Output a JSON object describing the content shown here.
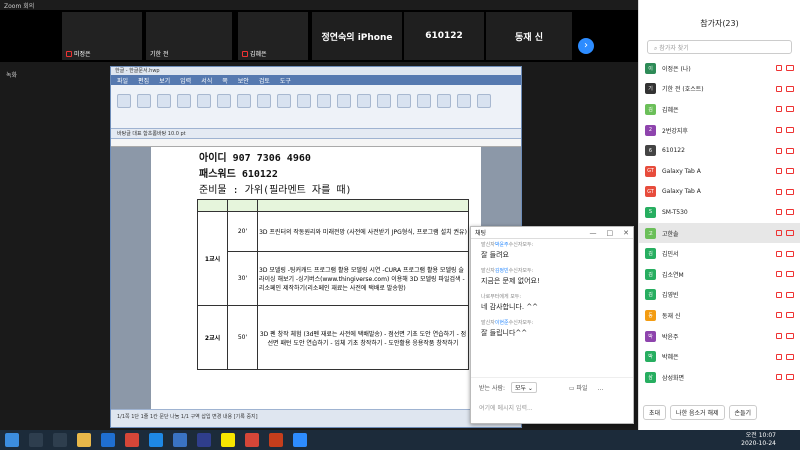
{
  "window": {
    "title": "Zoom 회의",
    "share_tag": "녹화"
  },
  "gallery": [
    {
      "name": "미정은",
      "bg": "#e9dcc9"
    },
    {
      "name": "기한 전",
      "bg": "#d6dbe0"
    },
    {
      "name": "김혜은",
      "bg": "#cfc6c0"
    }
  ],
  "name_tiles": [
    {
      "name": "정연숙의 iPhone"
    },
    {
      "name": "610122"
    },
    {
      "name": "동재 신"
    }
  ],
  "hwp": {
    "title": "한글 - 한글문서.hwp",
    "menu": [
      "파일",
      "편집",
      "보기",
      "입력",
      "서식",
      "쪽",
      "보안",
      "검토",
      "도구"
    ],
    "format_bar": "바탕글   대표   함초롬바탕   10.0 pt",
    "id_line": "아이디   907  7306  4960",
    "pw_line": "패스워드  610122",
    "prep_line": "준비물 : 가위(필라멘트 자를 때)",
    "rows": [
      {
        "period": "1교시",
        "time1": "20'",
        "content1": "3D 프린터의 작동원리와 미래전망 (사전에 사전받기 JPG형식, 프로그램 설치 권유)",
        "time2": "30'",
        "content2": "3D 모델링 -팅커캐드 프로그램 활용 모델링 시연 -CURA 프로그램 활용 모델링 슬라이싱 해보기 -싱기버스(www.thingiverse.com) 이용해 3D 모델링 파일검색 -리소페인 제작하기(리소페인 재료는 사전에 택배로 발송함)"
      },
      {
        "period": "2교시",
        "time": "50'",
        "content": "3D 펜 창작 체험 (3d펜 재료는 사전에 택배발송) - 점선면 기초 도안 연습하기 - 점선면 패턴 도안 연습하기 - 입체 기초 창작하기 - 도안활용 응용작품 창작하기"
      }
    ],
    "status": "1/1쪽  1단  1줄  1칸  문단 나눔  1/1 구역  삽입  변경 내용 [기록 중지]"
  },
  "chat": {
    "title": "채팅",
    "messages": [
      {
        "from_prefix": "발신자",
        "from": "박윤주",
        "to": "수신자모두:",
        "text": "잘 들려요"
      },
      {
        "from_prefix": "발신자",
        "from": "김정빈",
        "to": "수신자모두:",
        "text": "지금은 문제 없어요!"
      },
      {
        "from_prefix": "나로부터",
        "from": "",
        "to": "에게 모두:",
        "text": "네 감사합니다. ^^"
      },
      {
        "from_prefix": "발신자",
        "from": "이현준",
        "to": "수신자모두:",
        "text": "잘 들립니다^^"
      }
    ],
    "to_label": "받는 사람:",
    "to_value": "모두",
    "file_label": "파일",
    "input_placeholder": "여기에 메시지 입력..."
  },
  "participants": {
    "title": "참가자(23)",
    "search_placeholder": "참가자 찾기",
    "list": [
      {
        "initial": "이",
        "name": "이정은 (나)",
        "color": "#2e8b57"
      },
      {
        "initial": "기",
        "name": "기한 전 (호스트)",
        "color": "#333"
      },
      {
        "initial": "김",
        "name": "김혜은",
        "color": "#6bbf59"
      },
      {
        "initial": "2",
        "name": "2번강지후",
        "color": "#8e44ad"
      },
      {
        "initial": "6",
        "name": "610122",
        "color": "#444"
      },
      {
        "initial": "GT",
        "name": "Galaxy Tab A",
        "color": "#e74c3c"
      },
      {
        "initial": "GT",
        "name": "Galaxy Tab A",
        "color": "#e74c3c"
      },
      {
        "initial": "S",
        "name": "SM-T530",
        "color": "#27ae60"
      },
      {
        "initial": "고",
        "name": "고한솔",
        "color": "#6bbf59"
      },
      {
        "initial": "김",
        "name": "김민서",
        "color": "#27ae60"
      },
      {
        "initial": "김",
        "name": "김소연M",
        "color": "#27ae60"
      },
      {
        "initial": "김",
        "name": "김영빈",
        "color": "#27ae60"
      },
      {
        "initial": "동",
        "name": "동재 신",
        "color": "#f39c12"
      },
      {
        "initial": "박",
        "name": "박윤주",
        "color": "#8e44ad"
      },
      {
        "initial": "박",
        "name": "박혜은",
        "color": "#27ae60"
      },
      {
        "initial": "삼",
        "name": "삼성화면",
        "color": "#27ae60"
      }
    ],
    "btn_invite": "초대",
    "btn_mute": "나한 음소거 해제",
    "btn_more": "손들기"
  },
  "clock": {
    "time": "오전 10:07",
    "date": "2020-10-24"
  }
}
